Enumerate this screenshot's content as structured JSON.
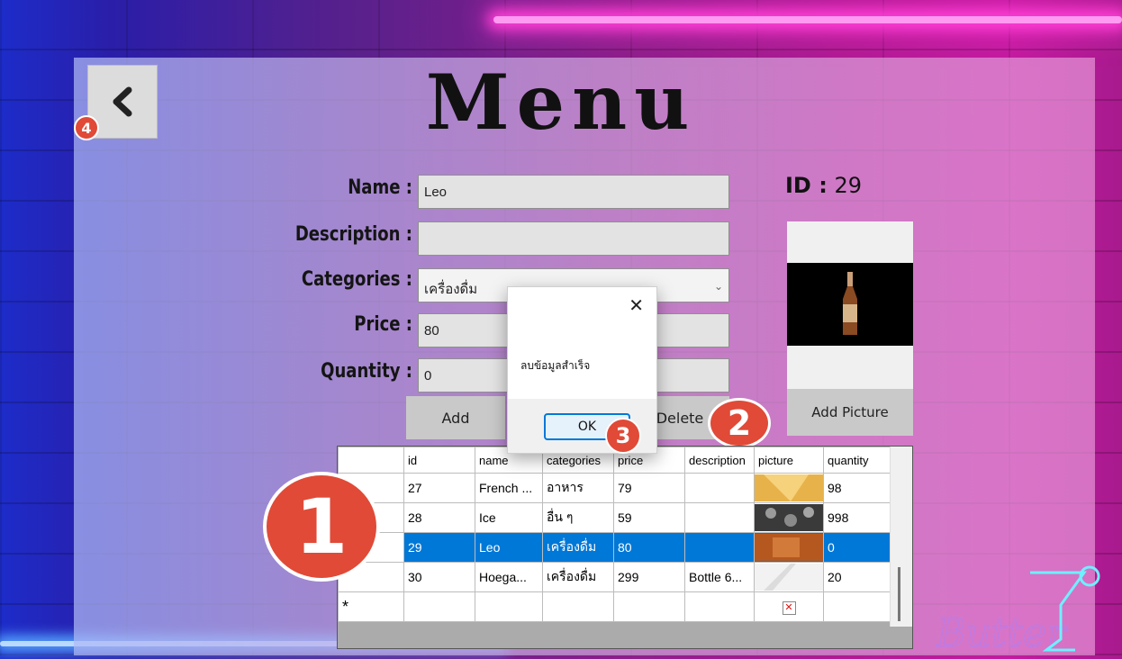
{
  "title": "Menu",
  "form": {
    "name_label": "Name :",
    "name_value": "Leo",
    "description_label": "Description :",
    "description_value": "",
    "categories_label": "Categories :",
    "categories_value": "เครื่องดื่ม",
    "price_label": "Price :",
    "price_value": "80",
    "quantity_label": "Quantity :",
    "quantity_value": "0"
  },
  "id": {
    "label": "ID :",
    "value": "29"
  },
  "buttons": {
    "add": "Add",
    "delete": "Delete",
    "add_picture": "Add Picture"
  },
  "dialog": {
    "message": "ลบข้อมูลสำเร็จ",
    "ok": "OK",
    "close": "✕"
  },
  "badges": [
    "1",
    "2",
    "3",
    "4"
  ],
  "table": {
    "columns": [
      "id",
      "name",
      "categories",
      "price",
      "description",
      "picture",
      "quantity"
    ],
    "rows": [
      {
        "id": "27",
        "name": "French ...",
        "categories": "อาหาร",
        "price": "79",
        "description": "",
        "picture": "fries",
        "quantity": "98",
        "selected": false
      },
      {
        "id": "28",
        "name": "Ice",
        "categories": "อื่น ๆ",
        "price": "59",
        "description": "",
        "picture": "ice",
        "quantity": "998",
        "selected": false
      },
      {
        "id": "29",
        "name": "Leo",
        "categories": "เครื่องดื่ม",
        "price": "80",
        "description": "",
        "picture": "beer",
        "quantity": "0",
        "selected": true
      },
      {
        "id": "30",
        "name": "Hoega...",
        "categories": "เครื่องดื่ม",
        "price": "299",
        "description": "Bottle 6...",
        "picture": "white",
        "quantity": "20",
        "selected": false
      }
    ],
    "new_row_marker": "*"
  },
  "logo_text": "Butter",
  "colors": {
    "selected_row": "#0078d7",
    "badge": "#e04a37",
    "neon_pink": "#ff3fd7"
  }
}
